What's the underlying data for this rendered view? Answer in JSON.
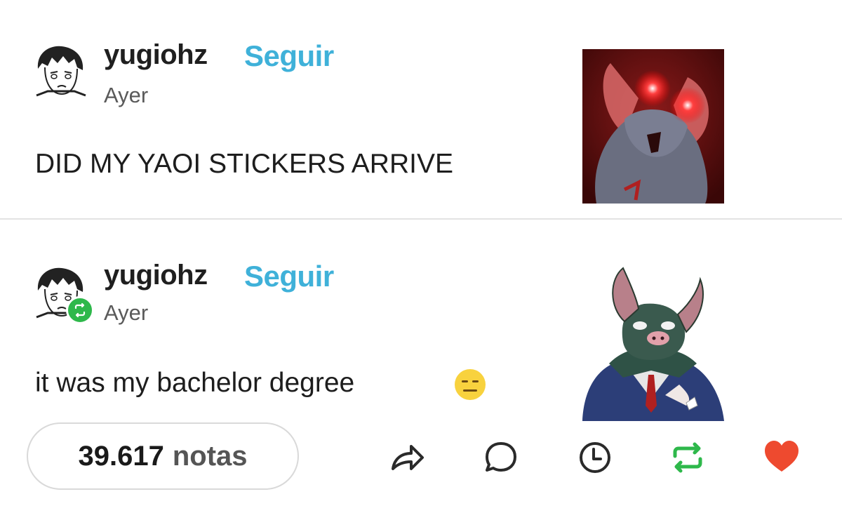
{
  "posts": [
    {
      "username": "yugiohz",
      "follow_label": "Seguir",
      "time": "Ayer",
      "text": "DID MY YAOI STICKERS ARRIVE",
      "avatar_icon": "manga-avatar",
      "sticker": "red-glowing-eyes-bat-sticker"
    },
    {
      "username": "yugiohz",
      "follow_label": "Seguir",
      "time": "Ayer",
      "text": "it was my bachelor degree",
      "emoji": "expressionless-face",
      "avatar_icon": "manga-avatar",
      "badge_icon": "reblog-badge-icon",
      "sticker": "bat-in-suit-sticker"
    }
  ],
  "footer": {
    "notes_count": "39.617",
    "notes_label": "notas",
    "actions": [
      "share-icon",
      "comment-icon",
      "clock-icon",
      "reblog-icon",
      "heart-icon"
    ]
  },
  "colors": {
    "follow": "#3fb1d9",
    "reblog": "#2eb84b",
    "like": "#ee4a2f",
    "divider": "#e3e3e3"
  }
}
